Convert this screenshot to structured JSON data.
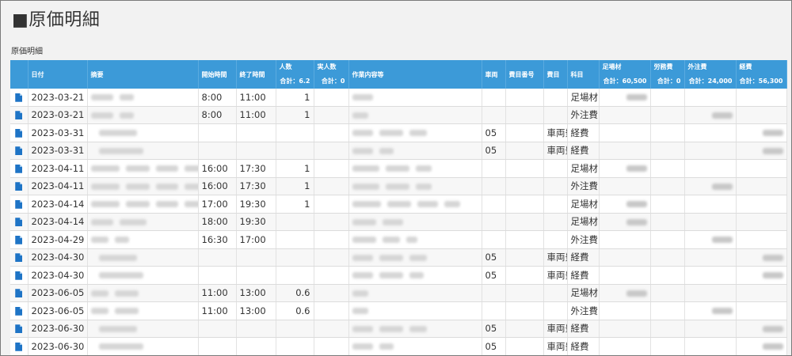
{
  "page": {
    "title": "■原価明細",
    "section_label": "原価明細"
  },
  "columns": {
    "date": "日付",
    "summary": "摘要",
    "start": "開始時間",
    "end": "終了時間",
    "people": "人数",
    "people_total": "合計：6.2",
    "actual": "実人数",
    "actual_total": "合計：0",
    "work": "作業内容等",
    "vehicle": "車両",
    "cost_code": "費目番号",
    "cost_item": "費目",
    "subject": "科目",
    "scaffold": "足場材",
    "scaffold_total": "合計：60,500",
    "labor": "労務費",
    "labor_total": "合計：0",
    "outsource": "外注費",
    "outsource_total": "合計：24,000",
    "expense": "経費",
    "expense_total": "合計：56,300"
  },
  "rows": [
    {
      "date": "2023-03-21",
      "start": "8:00",
      "end": "11:00",
      "people": "1",
      "vehicle": "",
      "cost_item": "",
      "subject": "足場材"
    },
    {
      "date": "2023-03-21",
      "start": "8:00",
      "end": "11:00",
      "people": "1",
      "vehicle": "",
      "cost_item": "",
      "subject": "外注費"
    },
    {
      "date": "2023-03-31",
      "start": "",
      "end": "",
      "people": "",
      "vehicle": "05",
      "cost_item": "車両費",
      "subject": "経費"
    },
    {
      "date": "2023-03-31",
      "start": "",
      "end": "",
      "people": "",
      "vehicle": "05",
      "cost_item": "車両費",
      "subject": "経費"
    },
    {
      "date": "2023-04-11",
      "start": "16:00",
      "end": "17:30",
      "people": "1",
      "vehicle": "",
      "cost_item": "",
      "subject": "足場材"
    },
    {
      "date": "2023-04-11",
      "start": "16:00",
      "end": "17:30",
      "people": "1",
      "vehicle": "",
      "cost_item": "",
      "subject": "外注費"
    },
    {
      "date": "2023-04-14",
      "start": "17:00",
      "end": "19:30",
      "people": "1",
      "vehicle": "",
      "cost_item": "",
      "subject": "足場材"
    },
    {
      "date": "2023-04-14",
      "start": "18:00",
      "end": "19:30",
      "people": "",
      "vehicle": "",
      "cost_item": "",
      "subject": "足場材"
    },
    {
      "date": "2023-04-29",
      "start": "16:30",
      "end": "17:00",
      "people": "",
      "vehicle": "",
      "cost_item": "",
      "subject": "外注費"
    },
    {
      "date": "2023-04-30",
      "start": "",
      "end": "",
      "people": "",
      "vehicle": "05",
      "cost_item": "車両費",
      "subject": "経費"
    },
    {
      "date": "2023-04-30",
      "start": "",
      "end": "",
      "people": "",
      "vehicle": "05",
      "cost_item": "車両費",
      "subject": "経費"
    },
    {
      "date": "2023-06-05",
      "start": "11:00",
      "end": "13:00",
      "people": "0.6",
      "vehicle": "",
      "cost_item": "",
      "subject": "足場材"
    },
    {
      "date": "2023-06-05",
      "start": "11:00",
      "end": "13:00",
      "people": "0.6",
      "vehicle": "",
      "cost_item": "",
      "subject": "外注費"
    },
    {
      "date": "2023-06-30",
      "start": "",
      "end": "",
      "people": "",
      "vehicle": "05",
      "cost_item": "車両費",
      "subject": "経費"
    },
    {
      "date": "2023-06-30",
      "start": "",
      "end": "",
      "people": "",
      "vehicle": "05",
      "cost_item": "車両費",
      "subject": "経費"
    }
  ],
  "icons": {
    "row_icon": "document-icon"
  },
  "colors": {
    "header_bg": "#3c9ad8",
    "icon": "#1e74c6"
  }
}
